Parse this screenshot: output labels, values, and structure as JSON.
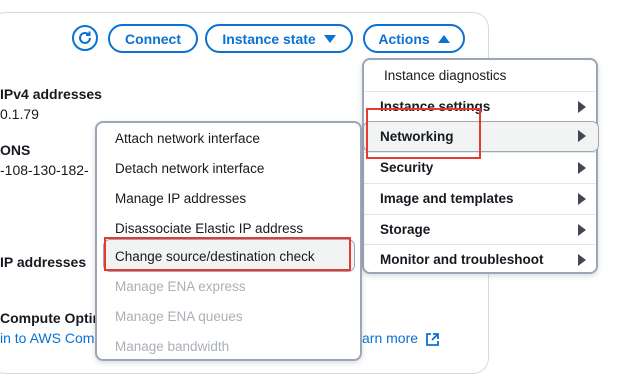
{
  "toolbar": {
    "connect_label": "Connect",
    "instance_state_label": "Instance state",
    "actions_label": "Actions"
  },
  "background": {
    "ipv4_heading": " IPv4 addresses",
    "ipv4_value": "0.1.79",
    "dns_heading": "ONS",
    "dns_value": "-108-130-182-",
    "ip_heading": "IP addresses",
    "compute_heading": "Compute Optimi",
    "compute_link": "in to AWS Comp",
    "learn_more": "arn more"
  },
  "actions_menu": {
    "items": [
      {
        "label": "Instance diagnostics",
        "has_submenu": false
      },
      {
        "label": "Instance settings",
        "has_submenu": true
      },
      {
        "label": "Networking",
        "has_submenu": true
      },
      {
        "label": "Security",
        "has_submenu": true
      },
      {
        "label": "Image and templates",
        "has_submenu": true
      },
      {
        "label": "Storage",
        "has_submenu": true
      },
      {
        "label": "Monitor and troubleshoot",
        "has_submenu": true
      }
    ]
  },
  "networking_submenu": {
    "items": [
      {
        "label": "Attach network interface",
        "disabled": false
      },
      {
        "label": "Detach network interface",
        "disabled": false
      },
      {
        "label": "Manage IP addresses",
        "disabled": false
      },
      {
        "label": "Disassociate Elastic IP address",
        "disabled": false
      },
      {
        "label": "Change source/destination check",
        "disabled": false
      },
      {
        "label": "Manage ENA express",
        "disabled": true
      },
      {
        "label": "Manage ENA queues",
        "disabled": true
      },
      {
        "label": "Manage bandwidth",
        "disabled": true
      }
    ]
  },
  "colors": {
    "accent": "#0972d3",
    "highlight": "#e8392f",
    "disabled_text": "#a9b0b7"
  }
}
